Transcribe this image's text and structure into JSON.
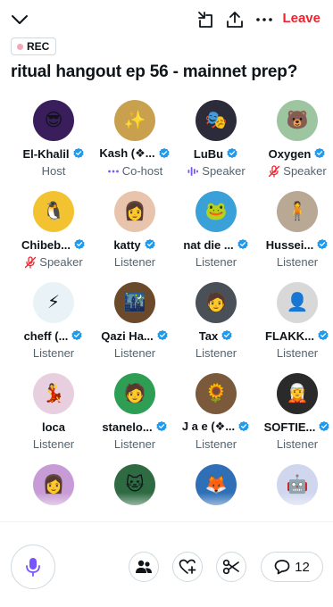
{
  "header": {
    "leave_label": "Leave"
  },
  "rec_label": "REC",
  "space_title": "ritual hangout ep 56 - mainnet prep?",
  "participants": [
    {
      "name": "El-Khalil",
      "role": "Host",
      "role_icon": "",
      "verified": true,
      "color": "#3a1e5c",
      "glyph": "😎"
    },
    {
      "name": "Kash (❖...",
      "role": "Co-host",
      "role_icon": "dots-icon",
      "verified": true,
      "color": "#c9a14e",
      "glyph": "✨"
    },
    {
      "name": "LuBu",
      "role": "Speaker",
      "role_icon": "sound-wave-icon",
      "verified": true,
      "color": "#2b2b3a",
      "glyph": "🎭"
    },
    {
      "name": "Oxygen",
      "role": "Speaker",
      "role_icon": "mic-muted-icon",
      "verified": true,
      "color": "#9cc5a0",
      "glyph": "🐻"
    },
    {
      "name": "Chibeb...",
      "role": "Speaker",
      "role_icon": "mic-muted-icon",
      "verified": true,
      "color": "#f2c230",
      "glyph": "🐧"
    },
    {
      "name": "katty",
      "role": "Listener",
      "role_icon": "",
      "verified": true,
      "color": "#e8c4ad",
      "glyph": "👩"
    },
    {
      "name": "nat die ...",
      "role": "Listener",
      "role_icon": "",
      "verified": true,
      "color": "#3aa0d8",
      "glyph": "🐸"
    },
    {
      "name": "Hussei...",
      "role": "Listener",
      "role_icon": "",
      "verified": true,
      "color": "#b8a894",
      "glyph": "🧍"
    },
    {
      "name": "cheff (...",
      "role": "Listener",
      "role_icon": "",
      "verified": true,
      "color": "#e9f3f7",
      "glyph": "⚡"
    },
    {
      "name": "Qazi Ha...",
      "role": "Listener",
      "role_icon": "",
      "verified": true,
      "color": "#6b4a2c",
      "glyph": "🌃"
    },
    {
      "name": "Tax",
      "role": "Listener",
      "role_icon": "",
      "verified": true,
      "color": "#4a5058",
      "glyph": "🧑"
    },
    {
      "name": "FLAKK...",
      "role": "Listener",
      "role_icon": "",
      "verified": true,
      "color": "#d8d8d8",
      "glyph": "👤"
    },
    {
      "name": "loca",
      "role": "Listener",
      "role_icon": "",
      "verified": false,
      "color": "#e7cfe0",
      "glyph": "💃"
    },
    {
      "name": "stanelo...",
      "role": "Listener",
      "role_icon": "",
      "verified": true,
      "color": "#2f9e55",
      "glyph": "🧑"
    },
    {
      "name": "J a e (❖...",
      "role": "Listener",
      "role_icon": "",
      "verified": true,
      "color": "#7a5a3a",
      "glyph": "🌻"
    },
    {
      "name": "SOFTIE...",
      "role": "Listener",
      "role_icon": "",
      "verified": true,
      "color": "#2a2a2a",
      "glyph": "🧝"
    },
    {
      "name": "",
      "role": "",
      "role_icon": "",
      "verified": false,
      "color": "#c79bd6",
      "glyph": "👩"
    },
    {
      "name": "",
      "role": "",
      "role_icon": "",
      "verified": false,
      "color": "#2e6b42",
      "glyph": "🐱"
    },
    {
      "name": "",
      "role": "",
      "role_icon": "",
      "verified": false,
      "color": "#2f6fb8",
      "glyph": "🦊"
    },
    {
      "name": "",
      "role": "",
      "role_icon": "",
      "verified": false,
      "color": "#cfd6ee",
      "glyph": "🤖"
    }
  ],
  "bottom": {
    "comments_count": "12"
  },
  "colors": {
    "accent_purple": "#7856ff",
    "leave_red": "#f4212e",
    "verified_blue": "#1d9bf0",
    "muted_red": "#f4212e"
  }
}
